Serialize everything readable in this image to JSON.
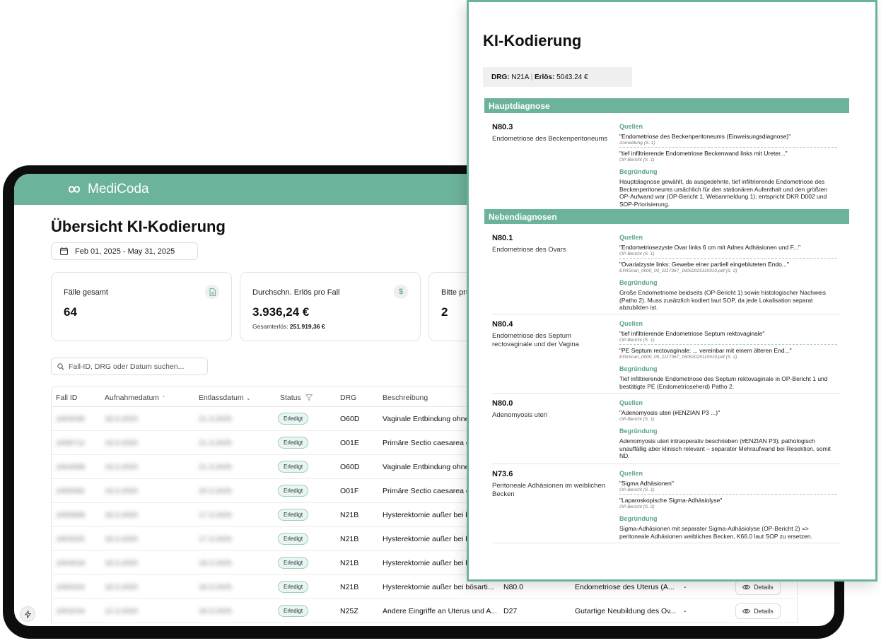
{
  "app": {
    "brand": "MediCoda"
  },
  "dashboard": {
    "title": "Übersicht KI-Kodierung",
    "date_range": "Feb 01, 2025 - May 31, 2025",
    "search_placeholder": "Fall-ID, DRG oder Datum suchen...",
    "stats": [
      {
        "label": "Fälle gesamt",
        "value": "64",
        "sub_label": "",
        "sub_value": "",
        "icon": "document-icon"
      },
      {
        "label": "Durchschn. Erlös pro Fall",
        "value": "3.936,24 €",
        "sub_label": "Gesamterlös:",
        "sub_value": "251.919,36 €",
        "icon": "dollar-icon"
      },
      {
        "label": "Bitte prü",
        "value": "2",
        "sub_label": "",
        "sub_value": "",
        "icon": ""
      }
    ],
    "columns": [
      "Fall ID",
      "Aufnahmedatum",
      "Entlassdatum",
      "Status",
      "DRG",
      "Beschreibung"
    ],
    "details_label": "Details",
    "rows": [
      {
        "fall_id": "1654036",
        "aufnahme": "18.3.2025",
        "entlass": "21.3.2025",
        "status": "Erledigt",
        "drg": "O60D",
        "beschreibung": "Vaginale Entbindung ohne",
        "code": "",
        "code_desc": "",
        "extra": ""
      },
      {
        "fall_id": "1658712",
        "aufnahme": "19.3.2025",
        "entlass": "21.3.2025",
        "status": "Erledigt",
        "drg": "O01E",
        "beschreibung": "Primäre Sectio caesarea o",
        "code": "",
        "code_desc": "",
        "extra": ""
      },
      {
        "fall_id": "1654068",
        "aufnahme": "19.3.2025",
        "entlass": "21.3.2025",
        "status": "Erledigt",
        "drg": "O60D",
        "beschreibung": "Vaginale Entbindung ohne",
        "code": "",
        "code_desc": "",
        "extra": ""
      },
      {
        "fall_id": "1655082",
        "aufnahme": "19.3.2025",
        "entlass": "20.3.2025",
        "status": "Erledigt",
        "drg": "O01F",
        "beschreibung": "Primäre Sectio caesarea o",
        "code": "",
        "code_desc": "",
        "extra": ""
      },
      {
        "fall_id": "1655908",
        "aufnahme": "18.3.2025",
        "entlass": "17.3.2025",
        "status": "Erledigt",
        "drg": "N21B",
        "beschreibung": "Hysterektomie außer bei b",
        "code": "",
        "code_desc": "",
        "extra": ""
      },
      {
        "fall_id": "1653325",
        "aufnahme": "18.3.2025",
        "entlass": "17.3.2025",
        "status": "Erledigt",
        "drg": "N21B",
        "beschreibung": "Hysterektomie außer bei b",
        "code": "",
        "code_desc": "",
        "extra": ""
      },
      {
        "fall_id": "1654618",
        "aufnahme": "18.3.2025",
        "entlass": "18.3.2025",
        "status": "Erledigt",
        "drg": "N21B",
        "beschreibung": "Hysterektomie außer bei b",
        "code": "",
        "code_desc": "",
        "extra": ""
      },
      {
        "fall_id": "1656316",
        "aufnahme": "18.3.2025",
        "entlass": "18.3.2025",
        "status": "Erledigt",
        "drg": "N21B",
        "beschreibung": "Hysterektomie außer bei bösarti...",
        "code": "N80.0",
        "code_desc": "Endometriose des Uterus (A...",
        "extra": "-"
      },
      {
        "fall_id": "1653244",
        "aufnahme": "12.3.2025",
        "entlass": "18.3.2025",
        "status": "Erledigt",
        "drg": "N25Z",
        "beschreibung": "Andere Eingriffe an Uterus und A...",
        "code": "D27",
        "code_desc": "Gutartige Neubildung des Ov...",
        "extra": "-"
      }
    ]
  },
  "panel": {
    "title": "KI-Kodierung",
    "drg_label": "DRG:",
    "drg_value": "N21A",
    "erloes_label": "Erlös:",
    "erloes_value": "5043.24 €",
    "main_header": "Hauptdiagnose",
    "side_header": "Nebendiagnosen",
    "sources_label": "Quellen",
    "reason_label": "Begründung",
    "main": {
      "code": "N80.3",
      "description": "Endometriose des Beckenperitoneums",
      "sources": [
        {
          "quote": "\"Endometriose des Beckenperitoneums (Einweisungsdiagnose)\"",
          "ref": "Anmeldung (S. 1)"
        },
        {
          "quote": "\"tief infiltrierende Endometriose Beckenwand links mit Ureter...\"",
          "ref": "OP-Bericht (S. 1)"
        }
      ],
      "reason": "Hauptdiagnose gewählt, da ausgedehnte, tief infiltrierende Endometriose des Beckenperitoneums ursächlich für den stationären Aufenthalt und den größten OP-Aufwand war (OP-Bericht 1, Webanmeldung 1); entspricht DKR D002 und SOP-Priorisierung."
    },
    "side": [
      {
        "code": "N80.1",
        "description": "Endometriose des Ovars",
        "sources": [
          {
            "quote": "\"Endometriosezyste Ovar links 6 cm mit Adnex Adhäsionen und F...\"",
            "ref": "OP-Bericht (S. 1)"
          },
          {
            "quote": "\"Ovarialzyste links: Gewebe einer partiell eingebluteten Endo...\"",
            "ref": "EPAScan_0000_00_1117367_16052025110910.pdf (S. 2)"
          }
        ],
        "reason": "Große Endometriome beidseits (OP-Bericht 1) sowie histologischer Nachweis (Patho 2). Muss zusätzlich kodiert laut SOP, da jede Lokalisation separat abzubilden ist."
      },
      {
        "code": "N80.4",
        "description": "Endometriose des Septum rectovaginale und der Vagina",
        "sources": [
          {
            "quote": "\"tief infiltrierende Endometriose Septum rektovaginale\"",
            "ref": "OP-Bericht (S. 1)"
          },
          {
            "quote": "\"PE Septum rectovaginale: ... vereinbar mit einem älteren End...\"",
            "ref": "EPAScan_0000_00_1117367_16052025110910.pdf (S. 2)"
          }
        ],
        "reason": "Tief infiltrierende Endometriose des Septum rektovaginale in OP-Bericht 1 und bestätigte PE (Endometrioseherd) Patho 2."
      },
      {
        "code": "N80.0",
        "description": "Adenomyosis uteri",
        "sources": [
          {
            "quote": "\"Adenomyosis uteri (#ENZIAN P3 ...)\"",
            "ref": "OP-Bericht (S. 1)"
          }
        ],
        "reason": "Adenomyosis uteri intraoperativ beschrieben (#ENZIAN P3); pathologisch unauffällig aber klinisch relevant – separater Mehraufwand bei Resektion, somit ND."
      },
      {
        "code": "N73.6",
        "description": "Peritoneale Adhäsionen im weiblichen Becken",
        "sources": [
          {
            "quote": "\"Sigma Adhäsionen\"",
            "ref": "OP-Bericht (S. 1)"
          },
          {
            "quote": "\"Laparoskopische Sigma-Adhäsiolyse\"",
            "ref": "OP-Bericht (S. 2)"
          }
        ],
        "reason": "Sigma-Adhäsionen mit separater Sigma-Adhäsiolyse (OP-Bericht 2) => peritoneale Adhäsionen weibliches Becken, K66.0 laut SOP zu ersetzen."
      }
    ]
  }
}
